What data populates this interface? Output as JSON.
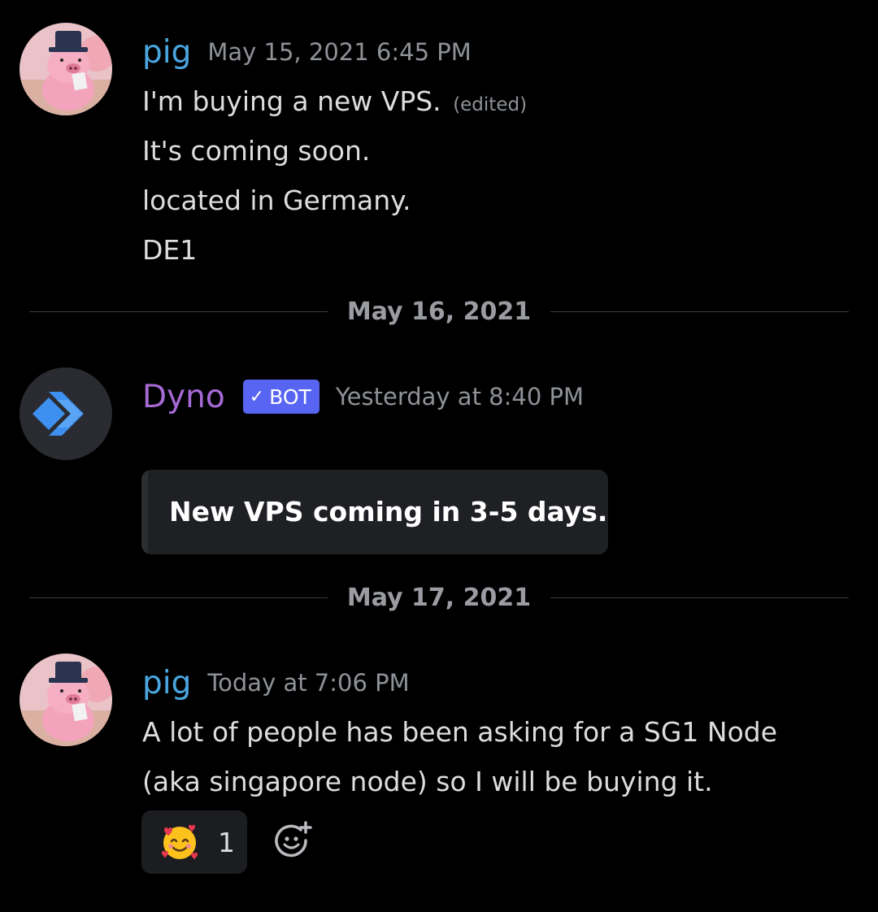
{
  "messages": [
    {
      "username": "pig",
      "timestamp": "May 15, 2021 6:45 PM",
      "lines": [
        {
          "text": "I'm buying a new VPS.",
          "edited": "(edited)"
        },
        {
          "text": "It's coming soon."
        },
        {
          "text": "located in Germany."
        },
        {
          "text": "DE1"
        }
      ]
    },
    {
      "username": "Dyno",
      "bot_tag": "BOT",
      "timestamp": "Yesterday at 8:40 PM",
      "embed_text": "New VPS coming in 3-5 days."
    },
    {
      "username": "pig",
      "timestamp": "Today at 7:06 PM",
      "lines": [
        {
          "text": "A lot of people has been asking for a SG1 Node"
        },
        {
          "text": "(aka singapore node) so I will be buying it."
        }
      ],
      "reaction": {
        "emoji": "smiling-face-with-hearts",
        "count": "1"
      }
    }
  ],
  "dividers": [
    "May 16, 2021",
    "May 17, 2021"
  ],
  "colors": {
    "background": "#000000",
    "pig_username": "#4aa6e0",
    "dyno_username": "#a66ad4",
    "bot_tag": "#5865f2",
    "timestamp": "#8e9297",
    "message_text": "#dcddde"
  }
}
